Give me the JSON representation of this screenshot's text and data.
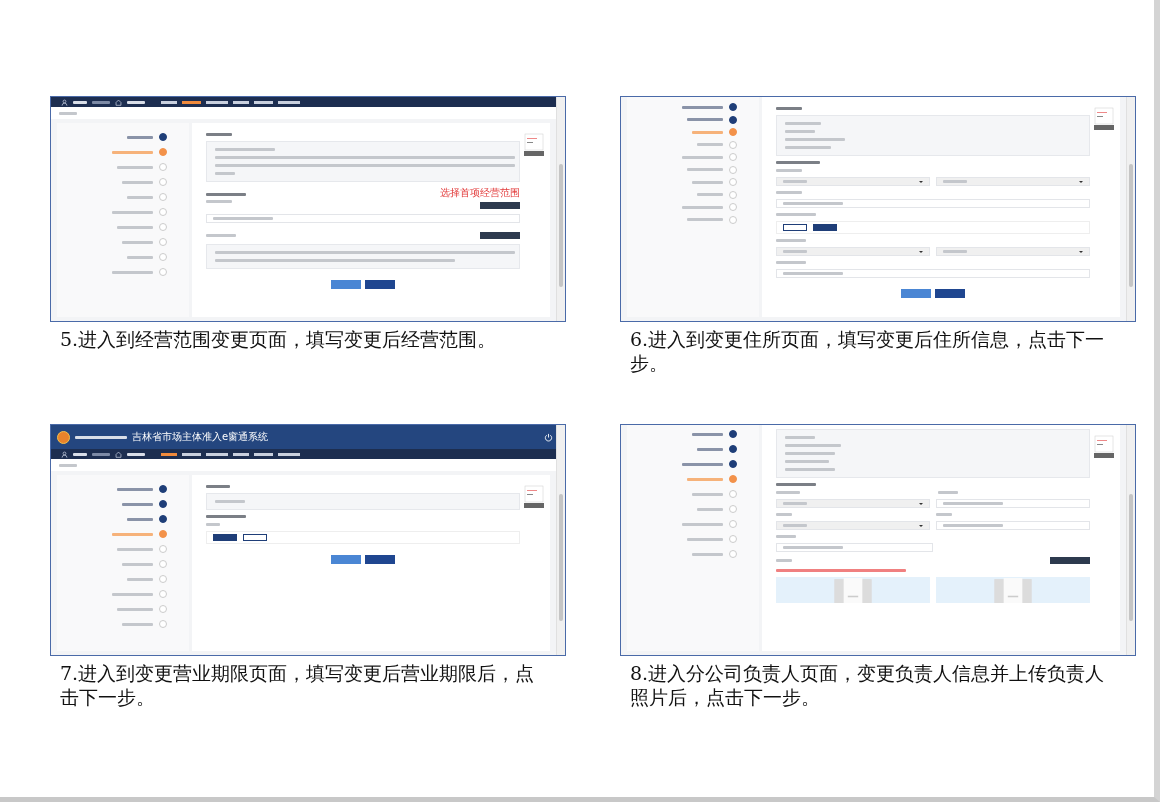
{
  "panels": [
    {
      "kind": "scope",
      "caption": "5.进入到经营范围变更页面，填写变更后经营范围。",
      "nav": {
        "items": [
          {
            "selected": false
          },
          {
            "selected": true
          },
          {
            "selected": false
          },
          {
            "selected": false
          },
          {
            "selected": false
          },
          {
            "selected": false
          }
        ]
      },
      "steps": [
        {
          "done": true,
          "selected": false
        },
        {
          "done": false,
          "selected": true
        },
        {
          "done": false,
          "selected": false
        },
        {
          "done": false,
          "selected": false
        },
        {
          "done": false,
          "selected": false
        },
        {
          "done": false,
          "selected": false
        },
        {
          "done": false,
          "selected": false
        },
        {
          "done": false,
          "selected": false
        },
        {
          "done": false,
          "selected": false
        },
        {
          "done": false,
          "selected": false
        }
      ],
      "annotation": "选择首项经营范围"
    },
    {
      "kind": "address",
      "caption": "6.进入到变更住所页面，填写变更后住所信息，点击下一步。",
      "steps": [
        {
          "done": true,
          "selected": false
        },
        {
          "done": true,
          "selected": false
        },
        {
          "done": false,
          "selected": true
        },
        {
          "done": false,
          "selected": false
        },
        {
          "done": false,
          "selected": false
        },
        {
          "done": false,
          "selected": false
        },
        {
          "done": false,
          "selected": false
        },
        {
          "done": false,
          "selected": false
        },
        {
          "done": false,
          "selected": false
        },
        {
          "done": false,
          "selected": false
        }
      ],
      "toggle": [
        {
          "selected": false
        },
        {
          "selected": true
        }
      ]
    },
    {
      "kind": "term",
      "caption": "7.进入到变更营业期限页面，填写变更后营业期限后，点击下一步。",
      "header": {
        "title": "吉林省市场主体准入e窗通系统"
      },
      "nav": {
        "items": [
          {
            "selected": true
          },
          {
            "selected": false
          },
          {
            "selected": false
          },
          {
            "selected": false
          },
          {
            "selected": false
          },
          {
            "selected": false
          }
        ]
      },
      "steps": [
        {
          "done": true,
          "selected": false
        },
        {
          "done": true,
          "selected": false
        },
        {
          "done": true,
          "selected": false
        },
        {
          "done": false,
          "selected": true
        },
        {
          "done": false,
          "selected": false
        },
        {
          "done": false,
          "selected": false
        },
        {
          "done": false,
          "selected": false
        },
        {
          "done": false,
          "selected": false
        },
        {
          "done": false,
          "selected": false
        },
        {
          "done": false,
          "selected": false
        }
      ],
      "toggle": [
        {
          "selected": true
        },
        {
          "selected": false
        }
      ]
    },
    {
      "kind": "manager",
      "caption": "8.进入分公司负责人页面，变更负责人信息并上传负责人照片后，点击下一步。",
      "steps": [
        {
          "done": true,
          "selected": false
        },
        {
          "done": true,
          "selected": false
        },
        {
          "done": true,
          "selected": false
        },
        {
          "done": false,
          "selected": true
        },
        {
          "done": false,
          "selected": false
        },
        {
          "done": false,
          "selected": false
        },
        {
          "done": false,
          "selected": false
        },
        {
          "done": false,
          "selected": false
        },
        {
          "done": false,
          "selected": false
        }
      ]
    }
  ]
}
